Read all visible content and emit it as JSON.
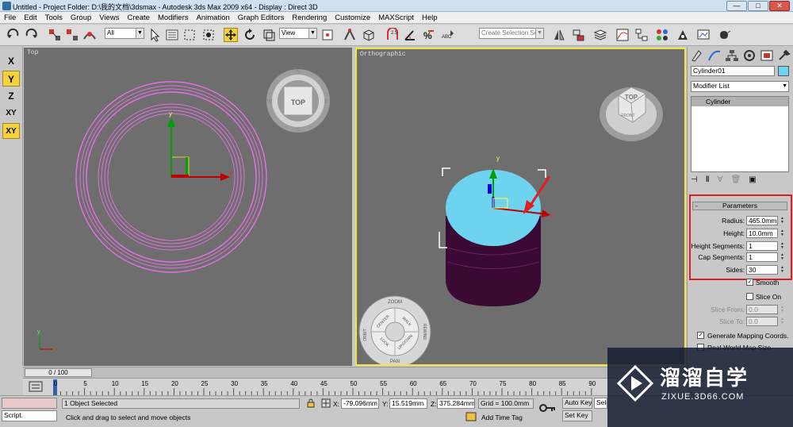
{
  "window": {
    "title": "Untitled     - Project Folder: D:\\我的文档\\3dsmax     - Autodesk 3ds Max  2009 x64      - Display : Direct 3D",
    "min_label": "—",
    "max_label": "□",
    "close_label": "✕"
  },
  "menu": [
    "File",
    "Edit",
    "Tools",
    "Group",
    "Views",
    "Create",
    "Modifiers",
    "Animation",
    "Graph Editors",
    "Rendering",
    "Customize",
    "MAXScript",
    "Help"
  ],
  "toolbar": {
    "selection_filter": "All",
    "reference_coord": "View",
    "named_selection_placeholder": "Create Selection Set"
  },
  "axis_constraints": {
    "x": "X",
    "y": "Y",
    "z": "Z",
    "xy": "XY",
    "xy2": "XY",
    "active": [
      "Y",
      "XY"
    ]
  },
  "viewports": {
    "top": {
      "label": "Top",
      "viewcube_face": "TOP",
      "compass_letters": [
        "N",
        "W",
        "E",
        "S"
      ],
      "gizmo_x": "x",
      "gizmo_y": "y",
      "axis_x": "x",
      "axis_y": "y"
    },
    "ortho": {
      "label": "Orthographic",
      "viewcube_top": "TOP",
      "viewcube_front": "FRONT",
      "gizmo_x": "x",
      "gizmo_y": "y",
      "wheel": {
        "zoom": "ZOOM",
        "orbit": "ORBIT",
        "center": "CENTER",
        "walk": "WALK",
        "rewind": "REWIND",
        "look": "LOOK",
        "updown": "UP/DOWN",
        "pan": "PAN"
      }
    }
  },
  "command_panel": {
    "object_name": "Cylinder01",
    "modifier_list": "Modifier List",
    "stack_item": "Cylinder",
    "rollout_toggle": "-",
    "rollout_title": "Parameters",
    "params": [
      {
        "label": "Radius:",
        "value": "465.0mm"
      },
      {
        "label": "Height:",
        "value": "10.0mm"
      },
      {
        "label": "Height Segments:",
        "value": "1"
      },
      {
        "label": "Cap Segments:",
        "value": "1"
      },
      {
        "label": "Sides:",
        "value": "30"
      }
    ],
    "smooth": {
      "label": "Smooth",
      "checked": true
    },
    "slice_on": {
      "label": "Slice On",
      "checked": false
    },
    "slice_from": {
      "label": "Slice From:",
      "value": "0.0"
    },
    "slice_to": {
      "label": "Slice To:",
      "value": "0.0"
    },
    "gen_mapping": {
      "label": "Generate Mapping Coords.",
      "checked": true
    },
    "real_world": {
      "label": "Real-World Map Size",
      "checked": false
    }
  },
  "timeline": {
    "frame_counter": "0 / 100",
    "ticks": [
      "0",
      "5",
      "10",
      "15",
      "20",
      "25",
      "30",
      "35",
      "40",
      "45",
      "50",
      "55",
      "60",
      "65",
      "70",
      "75",
      "80",
      "85",
      "90"
    ]
  },
  "status": {
    "selected": "1 Object Selected",
    "prompt": "Click and drag to select and move objects",
    "maxscript": "Script.",
    "x_label": "X:",
    "x_value": "-79.096mm",
    "y_label": "Y:",
    "y_value": "15.519mm",
    "z_label": "Z:",
    "z_value": "375.284mm",
    "grid": "Grid = 100.0mm",
    "add_time_tag": "Add Time Tag",
    "auto_key": "Auto Key",
    "set_key": "Set Key",
    "key_filter_value": "Sele"
  },
  "watermark": {
    "brand": "溜溜自学",
    "url": "ZIXUE.3D66.COM"
  },
  "colors": {
    "viewport_bg": "#6e6e6e",
    "wire_pink": "#e070e0",
    "cap_cyan": "#6dd3ef",
    "body_purple": "#3a0a34",
    "highlight_red": "#e02020",
    "active_yellow": "#f4d23c"
  }
}
